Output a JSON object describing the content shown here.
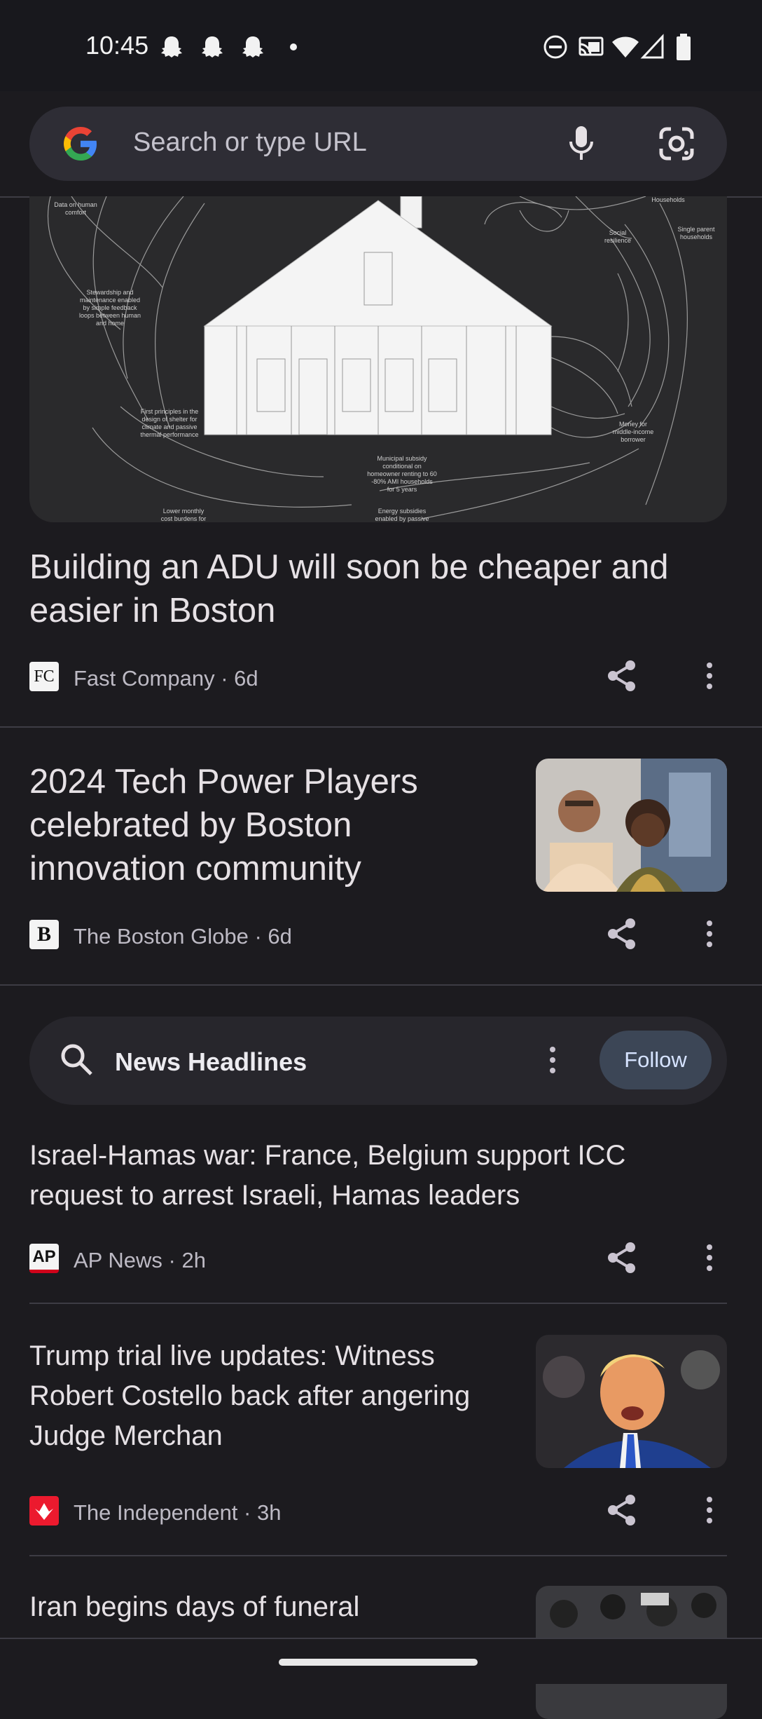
{
  "status": {
    "time": "10:45"
  },
  "search": {
    "placeholder": "Search or type URL"
  },
  "articles": [
    {
      "title_line1": "Building an ADU will soon be cheaper and",
      "title_line2": "easier in Boston",
      "source": "Fast Company · 6d",
      "logo_text": "FC"
    },
    {
      "title_line1": "2024 Tech Power Players",
      "title_line2": "celebrated by Boston",
      "title_line3": "innovation community",
      "source": "The Boston Globe · 6d",
      "logo_text": "B"
    }
  ],
  "hero_labels": {
    "l1": "Data on human",
    "l2": "comfort",
    "l3": "Stewardship and",
    "l4": "maintenance enabled",
    "l5": "by simple feedback",
    "l6": "loops between human",
    "l7": "and home",
    "l8": "First principles in the",
    "l9": "design of shelter for",
    "l10": "climate and passive",
    "l11": "thermal performance",
    "l12": "Lower monthly",
    "l13": "cost burdens for",
    "m1": "Municipal subsidy",
    "m2": "conditional on",
    "m3": "homeowner renting to 60",
    "m4": "-80% AMI households",
    "m5": "for 5 years",
    "m6": "Energy subsidies",
    "m7": "enabled by passive",
    "r1": "Households",
    "r2": "Social",
    "r3": "resilience",
    "r4": "Single parent",
    "r5": "households",
    "r6": "Money for",
    "r7": "middle-income",
    "r8": "borrower"
  },
  "topic": {
    "title": "News Headlines",
    "follow_label": "Follow"
  },
  "headlines": [
    {
      "line1": "Israel-Hamas war: France, Belgium support ICC",
      "line2": "request to arrest Israeli, Hamas leaders",
      "source": "AP News · 2h",
      "logo_text": "AP"
    },
    {
      "line1": "Trump trial live updates: Witness",
      "line2": "Robert Costello back after angering",
      "line3": "Judge Merchan",
      "source": "The Independent · 3h"
    },
    {
      "line1": "Iran begins days of funeral"
    }
  ]
}
